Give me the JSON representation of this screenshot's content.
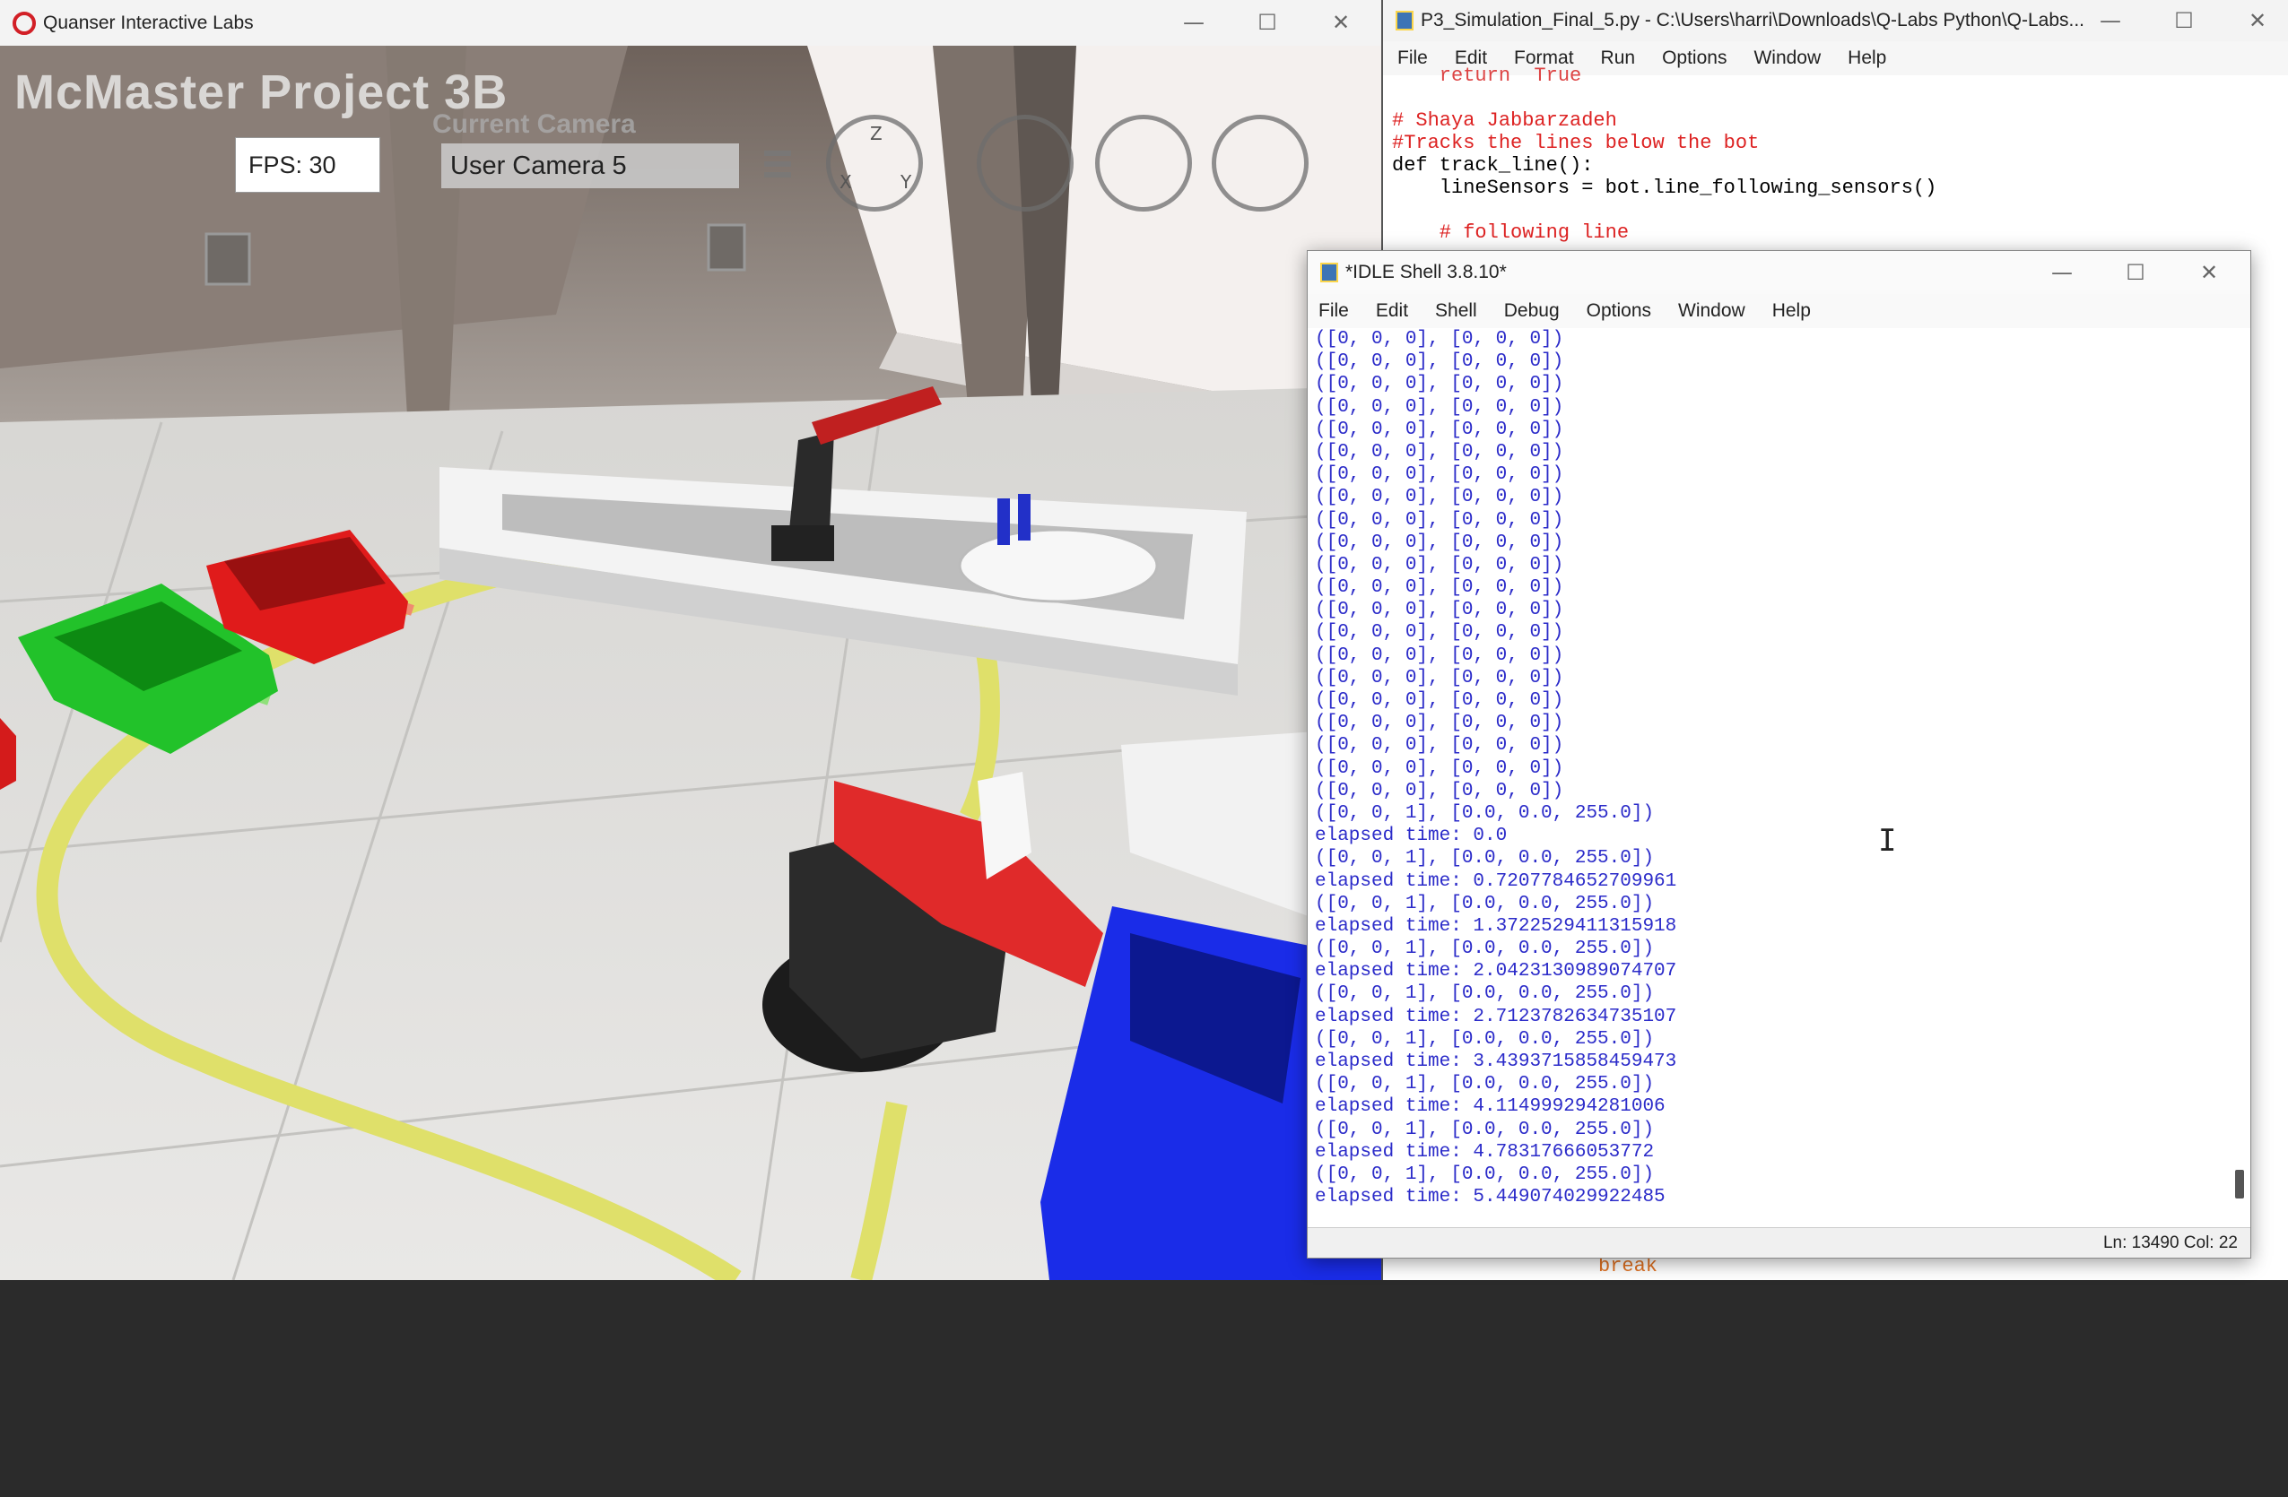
{
  "quanser": {
    "window_title": "Quanser Interactive Labs",
    "hud_title": "McMaster Project 3B",
    "camera_label": "Current Camera",
    "fps": "FPS: 30",
    "camera_value": "User Camera 5",
    "axis_labels": {
      "z": "Z",
      "x": "X",
      "y": "Y"
    }
  },
  "editor": {
    "window_title": "P3_Simulation_Final_5.py - C:\\Users\\harri\\Downloads\\Q-Labs Python\\Q-Labs...",
    "menu": [
      "File",
      "Edit",
      "Format",
      "Run",
      "Options",
      "Window",
      "Help"
    ],
    "code_lines": [
      {
        "text": "    return  True",
        "color": "#d44"
      },
      {
        "text": "",
        "color": "#000"
      },
      {
        "text": "# Shaya Jabbarzadeh",
        "color": "#d22"
      },
      {
        "text": "#Tracks the lines below the bot",
        "color": "#d22"
      },
      {
        "text": "def track_line():",
        "color": "#000"
      },
      {
        "text": "    lineSensors = bot.line_following_sensors()",
        "color": "#000"
      },
      {
        "text": "",
        "color": "#000"
      },
      {
        "text": "    # following line",
        "color": "#d22"
      }
    ],
    "bottom_code": "break"
  },
  "shell": {
    "window_title": "*IDLE Shell 3.8.10*",
    "menu": [
      "File",
      "Edit",
      "Shell",
      "Debug",
      "Options",
      "Window",
      "Help"
    ],
    "output_lines": [
      "([0, 0, 0], [0, 0, 0])",
      "([0, 0, 0], [0, 0, 0])",
      "([0, 0, 0], [0, 0, 0])",
      "([0, 0, 0], [0, 0, 0])",
      "([0, 0, 0], [0, 0, 0])",
      "([0, 0, 0], [0, 0, 0])",
      "([0, 0, 0], [0, 0, 0])",
      "([0, 0, 0], [0, 0, 0])",
      "([0, 0, 0], [0, 0, 0])",
      "([0, 0, 0], [0, 0, 0])",
      "([0, 0, 0], [0, 0, 0])",
      "([0, 0, 0], [0, 0, 0])",
      "([0, 0, 0], [0, 0, 0])",
      "([0, 0, 0], [0, 0, 0])",
      "([0, 0, 0], [0, 0, 0])",
      "([0, 0, 0], [0, 0, 0])",
      "([0, 0, 0], [0, 0, 0])",
      "([0, 0, 0], [0, 0, 0])",
      "([0, 0, 0], [0, 0, 0])",
      "([0, 0, 0], [0, 0, 0])",
      "([0, 0, 0], [0, 0, 0])",
      "([0, 0, 1], [0.0, 0.0, 255.0])",
      "elapsed time: 0.0",
      "([0, 0, 1], [0.0, 0.0, 255.0])",
      "elapsed time: 0.7207784652709961",
      "([0, 0, 1], [0.0, 0.0, 255.0])",
      "elapsed time: 1.3722529411315918",
      "([0, 0, 1], [0.0, 0.0, 255.0])",
      "elapsed time: 2.0423130989074707",
      "([0, 0, 1], [0.0, 0.0, 255.0])",
      "elapsed time: 2.7123782634735107",
      "([0, 0, 1], [0.0, 0.0, 255.0])",
      "elapsed time: 3.4393715858459473",
      "([0, 0, 1], [0.0, 0.0, 255.0])",
      "elapsed time: 4.114999294281006",
      "([0, 0, 1], [0.0, 0.0, 255.0])",
      "elapsed time: 4.78317666053772",
      "([0, 0, 1], [0.0, 0.0, 255.0])",
      "elapsed time: 5.449074029922485"
    ],
    "status": "Ln: 13490   Col: 22"
  },
  "window_controls": {
    "minimize": "—",
    "maximize": "☐",
    "close": "✕"
  }
}
